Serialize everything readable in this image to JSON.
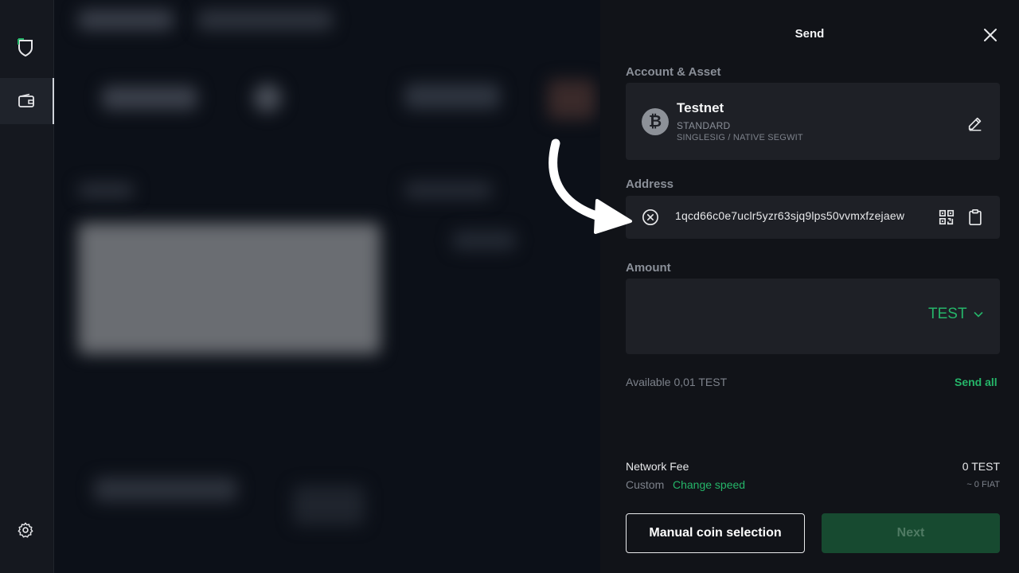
{
  "panel": {
    "title": "Send",
    "account_asset_label": "Account & Asset",
    "address_label": "Address",
    "amount_label": "Amount"
  },
  "asset": {
    "name": "Testnet",
    "type": "STANDARD",
    "subtype": "SINGLESIG / NATIVE SEGWIT",
    "icon": "bitcoin-icon"
  },
  "address": {
    "value": "1qcd66c0e7uclr5yzr63sjq9lps50vvmxfzejaew"
  },
  "amount": {
    "value": "",
    "unit": "TEST"
  },
  "available": {
    "text": "Available 0,01 TEST",
    "send_all_label": "Send all"
  },
  "fee": {
    "label": "Network Fee",
    "value": "0 TEST",
    "mode": "Custom",
    "change_speed_label": "Change speed",
    "fiat": "~ 0 FIAT"
  },
  "buttons": {
    "manual_label": "Manual coin selection",
    "next_label": "Next"
  },
  "colors": {
    "accent": "#25b569",
    "panel_bg": "#111318",
    "card_bg": "#1e2026",
    "next_bg_disabled": "#174a30"
  }
}
